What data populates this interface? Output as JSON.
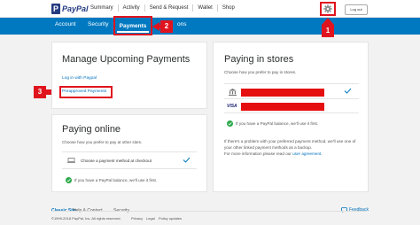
{
  "topbar": {
    "logo": "PayPal",
    "nav": [
      "Summary",
      "Activity",
      "Send & Request",
      "Wallet",
      "Shop"
    ],
    "logout": "Log out"
  },
  "subnav": {
    "account": "Account",
    "security": "Security",
    "payments": "Payments",
    "notifications_tail": "ons"
  },
  "callouts": [
    "1",
    "2",
    "3"
  ],
  "upcoming": {
    "title": "Manage Upcoming Payments",
    "login_link": "Log in with Paypal",
    "preapproved_link": "Preapproved Payments"
  },
  "online": {
    "title": "Paying online",
    "subtitle": "Choose how you prefer to pay at other sites.",
    "choose_method": "Choose a payment method at checkout",
    "balance_note": "If you have a PayPal balance, we'll use it first."
  },
  "stores": {
    "title": "Paying in stores",
    "subtitle": "Choose how you prefer to pay in stores.",
    "visa_label": "VISA",
    "balance_note": "If you have a PayPal balance, we'll use it first.",
    "problem_text_1": "If there's a problem with your preferred payment method, we'll use one of",
    "problem_text_2": "your other linked payment methods as a backup.",
    "problem_text_3": "For more information please read our",
    "agreement_link": "user agreement."
  },
  "footer": {
    "classic_site": "Classic Site",
    "help_contact": "Help & Contact",
    "security": "Security",
    "feedback": "Feedback",
    "copyright": "©1999-2018 PayPal, Inc. All rights reserved.",
    "privacy": "Privacy",
    "legal": "Legal",
    "policy_updates": "Policy updates"
  },
  "colors": {
    "brand_blue": "#0079c1",
    "callout_red": "#e0141e",
    "check_green": "#2ba84a"
  }
}
